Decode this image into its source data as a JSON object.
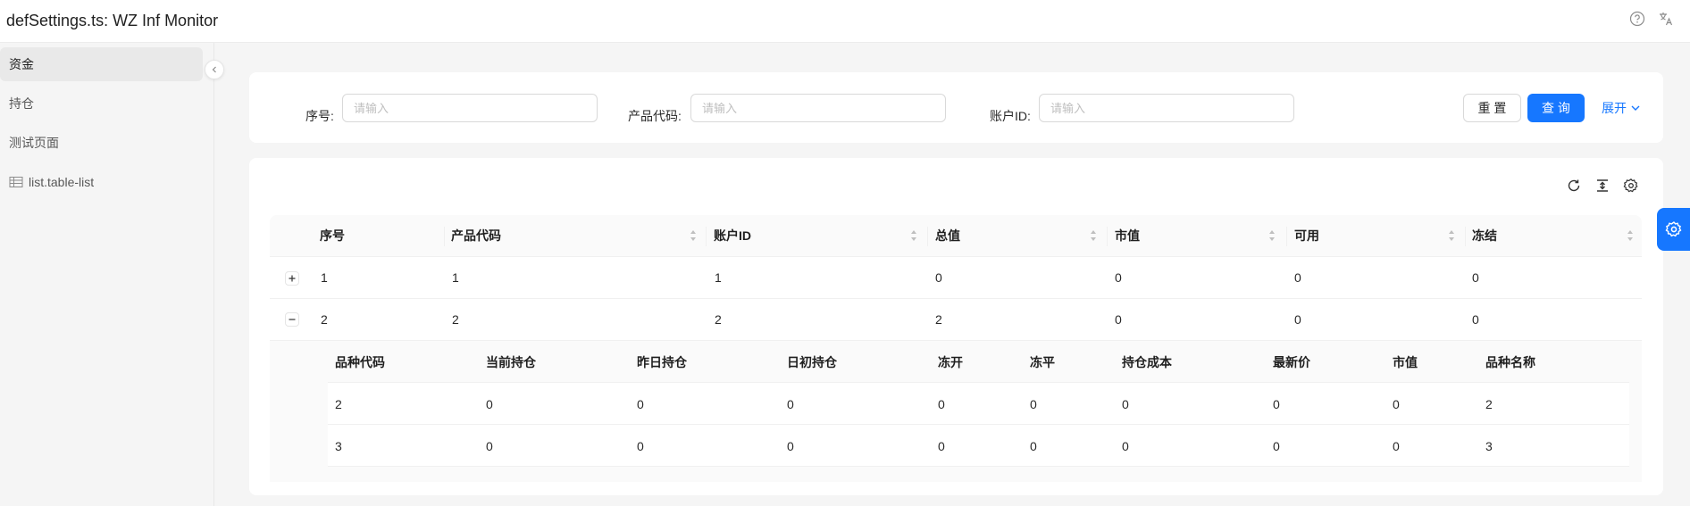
{
  "app": {
    "title": "defSettings.ts: WZ Inf Monitor"
  },
  "header_icons": [
    "help-icon",
    "translate-icon"
  ],
  "sidebar": {
    "items": [
      {
        "label": "资金",
        "active": true
      },
      {
        "label": "持仓",
        "active": false
      },
      {
        "label": "测试页面",
        "active": false
      },
      {
        "label": "list.table-list",
        "active": false,
        "icon": "table-icon"
      }
    ]
  },
  "search": {
    "fields": [
      {
        "label": "序号:",
        "placeholder": "请输入"
      },
      {
        "label": "产品代码:",
        "placeholder": "请输入"
      },
      {
        "label": "账户ID:",
        "placeholder": "请输入"
      }
    ],
    "reset_label": "重 置",
    "query_label": "查 询",
    "expand_label": "展开"
  },
  "toolbar": {
    "icons": [
      "reload-icon",
      "density-icon",
      "setting-icon"
    ]
  },
  "table": {
    "columns": [
      "序号",
      "产品代码",
      "账户ID",
      "总值",
      "市值",
      "可用",
      "冻结"
    ],
    "sortable": [
      false,
      true,
      true,
      true,
      true,
      true,
      true
    ],
    "rows": [
      {
        "expanded": false,
        "cells": [
          "1",
          "1",
          "1",
          "0",
          "0",
          "0",
          "0"
        ]
      },
      {
        "expanded": true,
        "cells": [
          "2",
          "2",
          "2",
          "2",
          "0",
          "0",
          "0"
        ]
      }
    ]
  },
  "sub_table": {
    "columns": [
      "品种代码",
      "当前持仓",
      "昨日持仓",
      "日初持仓",
      "冻开",
      "冻平",
      "持仓成本",
      "最新价",
      "市值",
      "品种名称"
    ],
    "rows": [
      [
        "2",
        "0",
        "0",
        "0",
        "0",
        "0",
        "0",
        "0",
        "0",
        "2"
      ],
      [
        "3",
        "0",
        "0",
        "0",
        "0",
        "0",
        "0",
        "0",
        "0",
        "3"
      ]
    ]
  },
  "colors": {
    "primary": "#1677ff",
    "background": "#f5f5f5"
  }
}
